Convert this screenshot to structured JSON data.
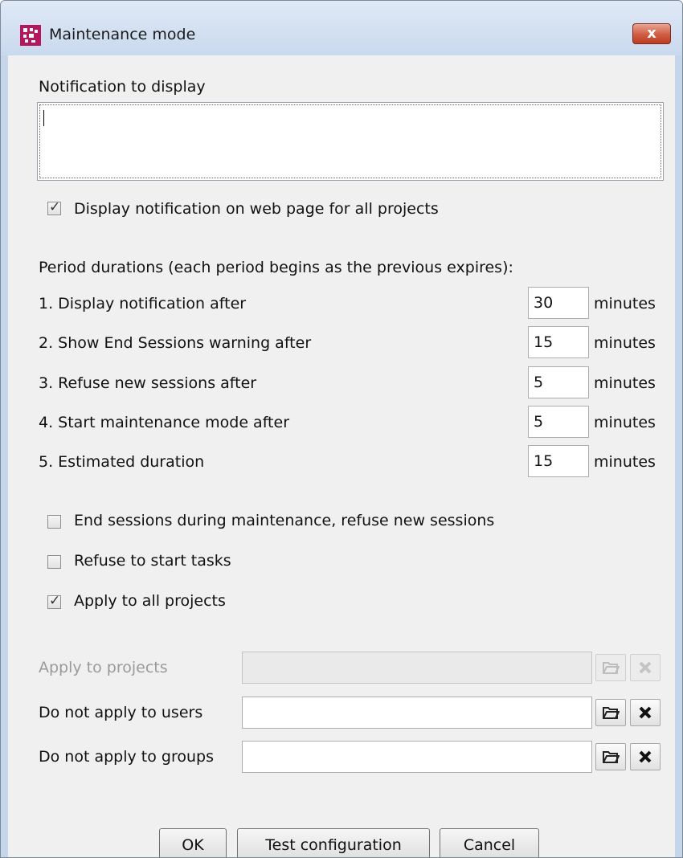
{
  "window": {
    "title": "Maintenance mode",
    "close_glyph": "x"
  },
  "notification": {
    "label": "Notification to display",
    "value": "",
    "display_checkbox": {
      "label": "Display notification on web page for all projects",
      "checked": true
    }
  },
  "periods": {
    "heading": "Period durations (each period begins as the previous expires):",
    "unit": "minutes",
    "rows": [
      {
        "label": "1. Display notification after",
        "value": "30"
      },
      {
        "label": "2. Show End Sessions warning after",
        "value": "15"
      },
      {
        "label": "3. Refuse new sessions after",
        "value": "5"
      },
      {
        "label": "4. Start maintenance mode after",
        "value": "5"
      },
      {
        "label": "5. Estimated duration",
        "value": "15"
      }
    ]
  },
  "options": [
    {
      "label": "End sessions during maintenance, refuse new sessions",
      "checked": false
    },
    {
      "label": "Refuse to start tasks",
      "checked": false
    },
    {
      "label": "Apply to all projects",
      "checked": true
    }
  ],
  "selectors": [
    {
      "label": "Apply to projects",
      "value": "",
      "enabled": false
    },
    {
      "label": "Do not apply to users",
      "value": "",
      "enabled": true
    },
    {
      "label": "Do not apply to groups",
      "value": "",
      "enabled": true
    }
  ],
  "buttons": {
    "ok": "OK",
    "test": "Test configuration",
    "cancel": "Cancel"
  },
  "colors": {
    "window_frame": "#c6d6ea",
    "client_bg": "#f0f0f0",
    "app_icon": "#b5165d",
    "close_button": "#cf5c41"
  },
  "icons": {
    "browse": "open-folder-icon",
    "clear": "x-icon",
    "app": "app-logo-icon"
  }
}
